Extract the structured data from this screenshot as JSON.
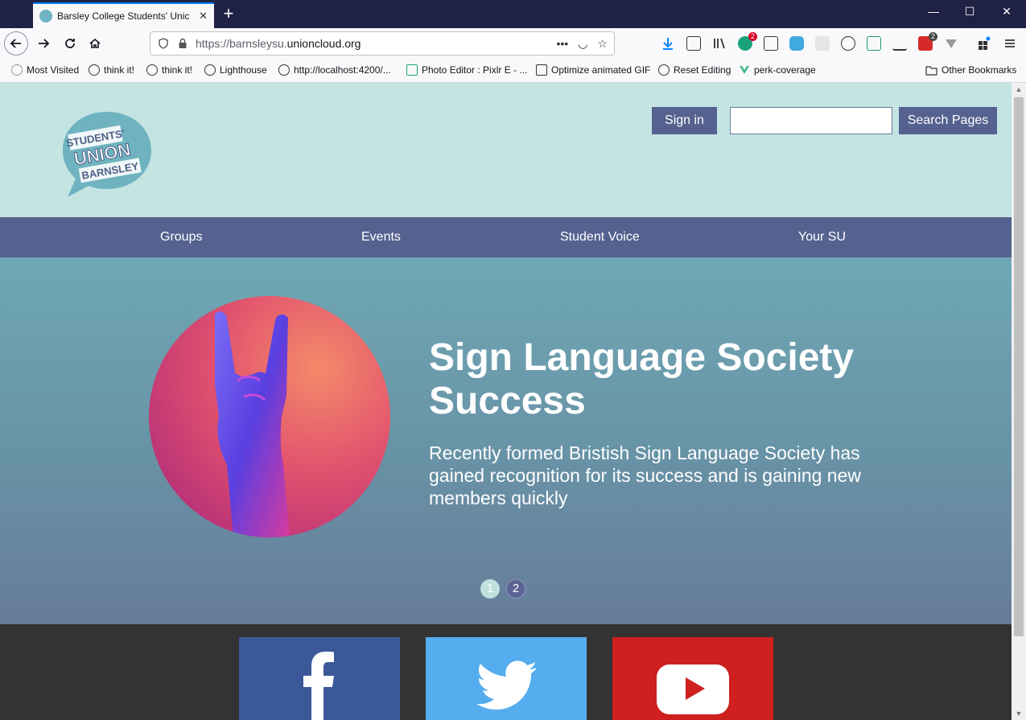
{
  "browser": {
    "tab_title": "Barsley College Students' Unic",
    "tab_close": "✕",
    "new_tab": "+",
    "window_controls": {
      "minimize": "—",
      "maximize": "☐",
      "close": "✕"
    },
    "url_prefix": "https://barnsleysu.",
    "url_domain": "unioncloud.org",
    "url_actions": {
      "more": "•••",
      "pocket": "◡",
      "bookmark": "☆"
    },
    "extension_badges": [
      "2",
      "2"
    ],
    "bookmarks": [
      "Most Visited",
      "think it!",
      "think it!",
      "Lighthouse",
      "http://localhost:4200/...",
      "Photo Editor : Pixlr E - ...",
      "Optimize animated GIF",
      "Reset Editing",
      "perk-coverage"
    ],
    "other_bookmarks": "Other Bookmarks"
  },
  "header": {
    "logo_lines": [
      "STUDENTS'",
      "UNION",
      "BARNSLEY"
    ],
    "signin_label": "Sign in",
    "search_value": "",
    "search_button_label": "Search Pages"
  },
  "nav": {
    "items": [
      "Groups",
      "Events",
      "Student Voice",
      "Your SU"
    ]
  },
  "hero": {
    "title": "Sign Language Society Success",
    "subtitle": "Recently formed Bristish Sign Language Society has gained recognition for its success and is gaining new members quickly",
    "slides": [
      "1",
      "2"
    ],
    "active_slide": 1
  },
  "footer": {
    "social": [
      {
        "name": "facebook",
        "color": "#3b5998"
      },
      {
        "name": "twitter",
        "color": "#55acee"
      },
      {
        "name": "youtube",
        "color": "#cd201f"
      }
    ]
  },
  "colors": {
    "header_bg": "#c4e4e2",
    "nav_bg": "#55628f",
    "footer_bg": "#333333",
    "titlebar_bg": "#1f2245"
  }
}
